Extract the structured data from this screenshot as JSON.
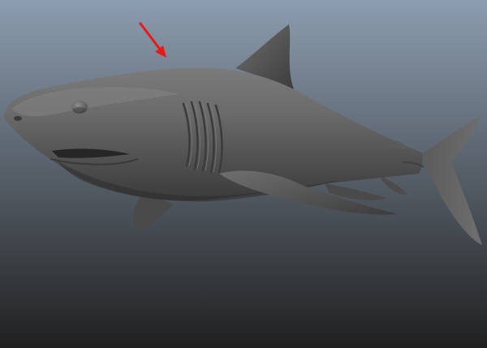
{
  "viewport": {
    "background_top_color": "#8c9db0",
    "background_bottom_color": "#202020"
  },
  "model": {
    "kind": "shark",
    "shading": "smooth",
    "base_color": "#5c5c5c",
    "highlight_color": "#8a8a8a",
    "shadow_color": "#2a2a2a"
  },
  "annotation": {
    "icon": "arrow-icon",
    "color": "#e81919"
  }
}
